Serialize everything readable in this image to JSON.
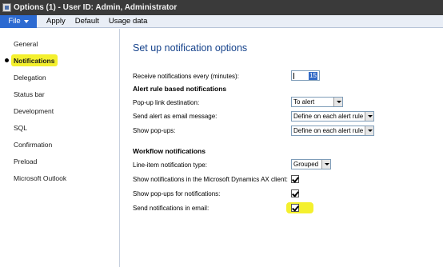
{
  "window": {
    "title": "Options (1) - User ID: Admin, Administrator"
  },
  "menu": {
    "file": "File",
    "items": [
      "Apply",
      "Default",
      "Usage data"
    ]
  },
  "sidebar": {
    "items": [
      "General",
      "Notifications",
      "Delegation",
      "Status bar",
      "Development",
      "SQL",
      "Confirmation",
      "Preload",
      "Microsoft Outlook"
    ],
    "active_index": 1
  },
  "main": {
    "title": "Set up notification options",
    "receive_label": "Receive notifications every (minutes):",
    "receive_value": "15",
    "alert_section": "Alert rule based notifications",
    "popup_link_label": "Pop-up link destination:",
    "popup_link_value": "To alert",
    "send_alert_email_label": "Send alert as email message:",
    "send_alert_email_value": "Define on each alert rule",
    "show_popups_label": "Show pop-ups:",
    "show_popups_value": "Define on each alert rule",
    "workflow_section": "Workflow notifications",
    "line_item_label": "Line-item notification type:",
    "line_item_value": "Grouped",
    "show_in_client_label": "Show notifications in the Microsoft Dynamics AX client:",
    "show_popups_for_label": "Show pop-ups for notifications:",
    "send_email_label": "Send notifications in email:"
  },
  "colors": {
    "titlebar": "#3a3a3a",
    "file_button": "#2c6ad1",
    "title_blue": "#15428b",
    "highlight": "#f4f02e"
  }
}
